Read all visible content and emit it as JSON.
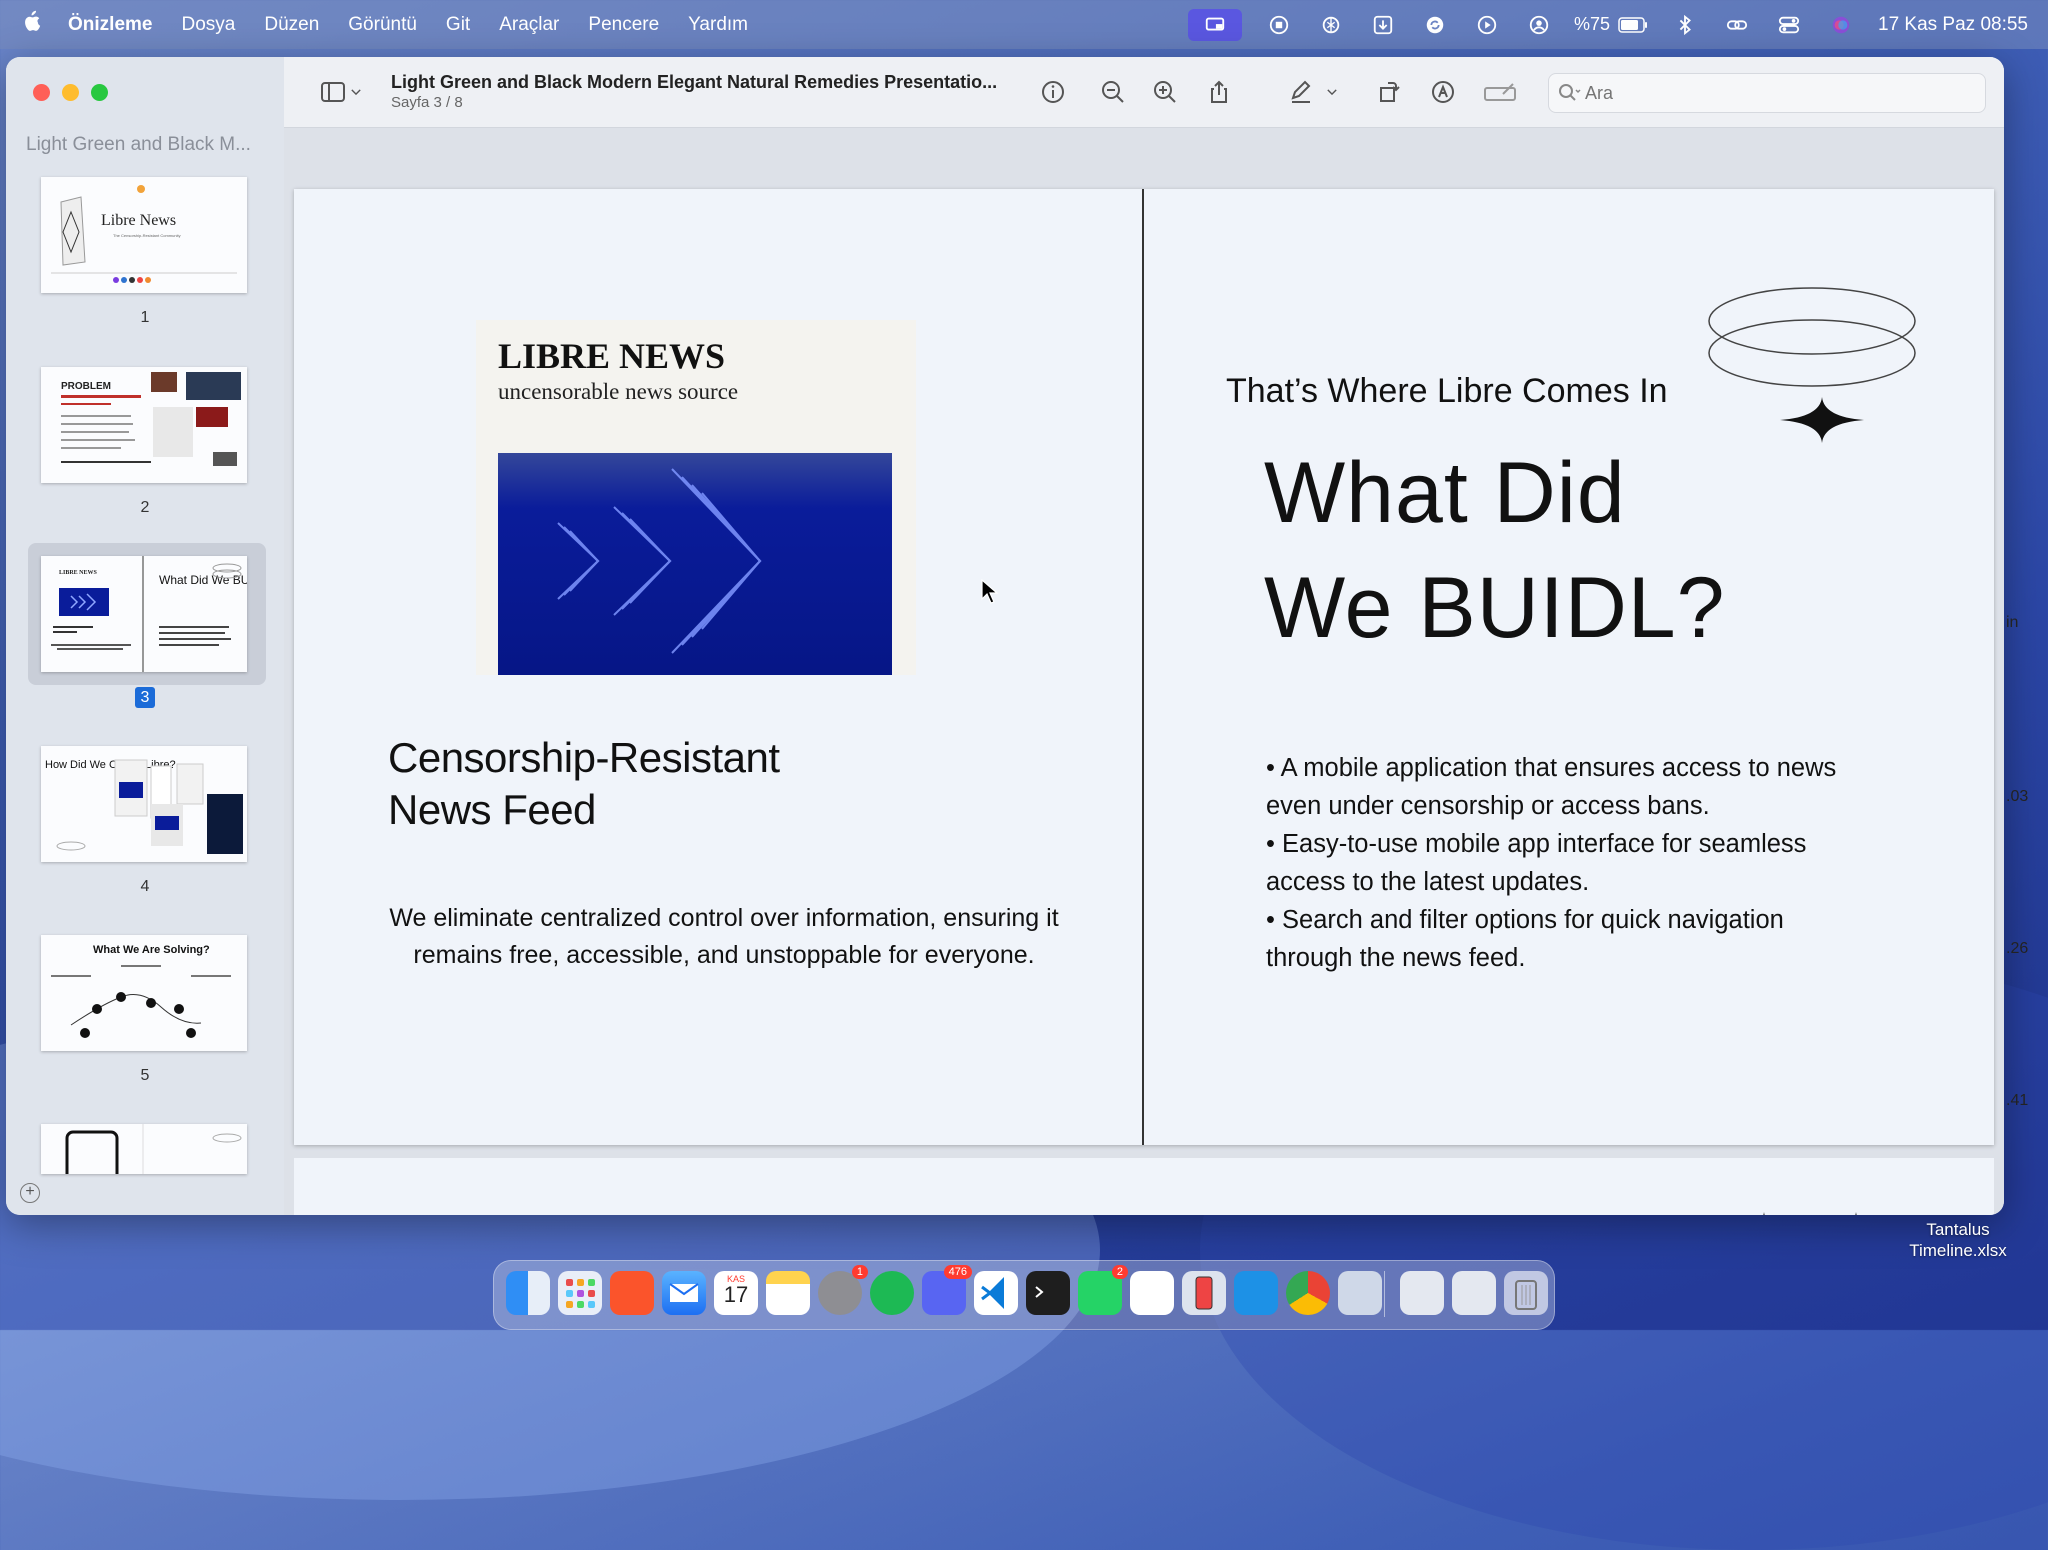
{
  "menubar": {
    "apple": "",
    "items": [
      "Önizleme",
      "Dosya",
      "Düzen",
      "Görüntü",
      "Git",
      "Araçlar",
      "Pencere",
      "Yardım"
    ],
    "battery": "%75",
    "datetime": "17 Kas Paz  08:55"
  },
  "window": {
    "sidebar_title": "Light Green and Black M...",
    "doc_title": "Light Green and Black Modern Elegant Natural Remedies Presentatio...",
    "doc_subtitle": "Sayfa 3 / 8",
    "search_placeholder": "Ara",
    "thumbnails": [
      {
        "num": "1",
        "title": "Libre News",
        "subtitle": "The Censorship-Resistant Community"
      },
      {
        "num": "2",
        "title": "PROBLEM"
      },
      {
        "num": "3",
        "selected": true,
        "left": "LIBRE NEWS",
        "right": "What Did We BUIDL?"
      },
      {
        "num": "4",
        "title": "How Did We Create Libre?"
      },
      {
        "num": "5",
        "title": "What We Are Solving?"
      }
    ]
  },
  "slide": {
    "libre_title": "LIBRE NEWS",
    "libre_subtitle": "uncensorable news source",
    "feed_title_1": "Censorship-Resistant",
    "feed_title_2": "News Feed",
    "feed_body": "We eliminate centralized control over information, ensuring it remains free, accessible, and unstoppable for everyone.",
    "kicker": "That’s Where Libre Comes In",
    "heading_1": "What Did",
    "heading_2": "We BUIDL?",
    "bullets": [
      " • A mobile application that ensures access to news even under censorship or access bans.",
      "• Easy-to-use mobile app interface for seamless access to the latest updates.",
      " • Search and filter options for quick navigation through the news feed."
    ]
  },
  "background_window": {
    "fragments": [
      "in",
      ".03",
      ".26",
      ".41"
    ]
  },
  "desktop": {
    "file_name_1": "Tantalus",
    "file_name_2": "Timeline.xlsx"
  },
  "dock": {
    "badges": {
      "settings": "1",
      "discord": "476",
      "whatsapp": "2"
    },
    "calendar_month": "KAS",
    "calendar_day": "17"
  },
  "colors": {
    "accent": "#5a57e0",
    "selection": "#1b6bd8",
    "slide_bg": "#f0f4fa",
    "libre_blue": "#061686"
  }
}
